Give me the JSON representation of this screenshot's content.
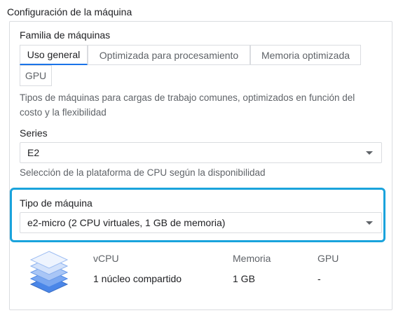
{
  "section_title": "Configuración de la máquina",
  "machine_family": {
    "label": "Familia de máquinas",
    "tabs": [
      {
        "label": "Uso general",
        "selected": true
      },
      {
        "label": "Optimizada para procesamiento",
        "selected": false
      },
      {
        "label": "Memoria optimizada",
        "selected": false
      },
      {
        "label": "GPU",
        "selected": false
      }
    ],
    "helper": "Tipos de máquinas para cargas de trabajo comunes, optimizados en función del costo y la flexibilidad"
  },
  "series": {
    "label": "Series",
    "value": "E2",
    "helper": "Selección de la plataforma de CPU según la disponibilidad"
  },
  "machine_type": {
    "label": "Tipo de máquina",
    "value": "e2-micro (2 CPU virtuales, 1 GB de memoria)"
  },
  "specs": {
    "icon": "stacked-layers-icon",
    "headers": [
      "vCPU",
      "Memoria",
      "GPU"
    ],
    "values": [
      "1 núcleo compartido",
      "1 GB",
      "-"
    ]
  },
  "colors": {
    "accent": "#1a73e8",
    "highlight": "#1aa3dc",
    "icon_fill": "#4a86e8"
  }
}
